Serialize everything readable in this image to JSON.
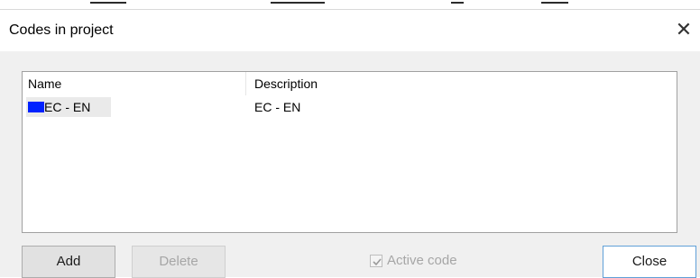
{
  "window": {
    "title": "Codes in project"
  },
  "table": {
    "headers": [
      "Name",
      "Description"
    ],
    "rows": [
      {
        "name": "EC - EN",
        "description": "EC - EN",
        "color": "#0022ff"
      }
    ]
  },
  "buttons": {
    "add": "Add",
    "delete": "Delete",
    "close": "Close"
  },
  "active_code": {
    "label": "Active code",
    "checked": true,
    "enabled": false
  },
  "icons": {
    "close": "close-icon",
    "check": "check-icon"
  }
}
